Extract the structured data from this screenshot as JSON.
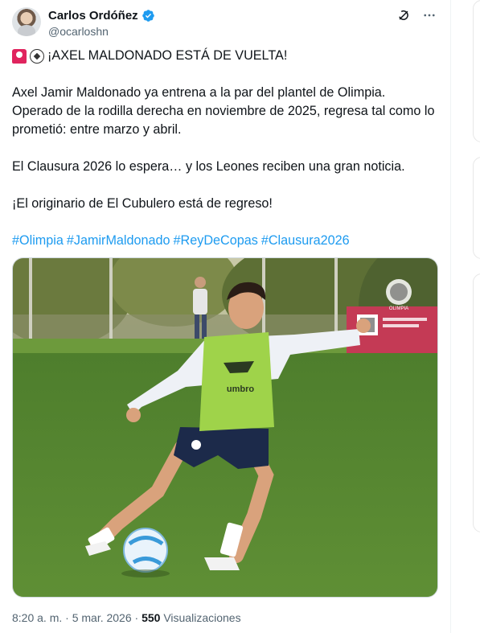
{
  "author": {
    "name": "Carlos Ordóñez",
    "handle": "@ocarloshn",
    "verified": true
  },
  "tweet": {
    "headline": "¡AXEL MALDONADO ESTÁ DE VUELTA!",
    "lines": [
      "Axel Jamir Maldonado ya entrena a la par del plantel de Olimpia.",
      "Operado de la rodilla derecha en noviembre de 2025, regresa tal como lo",
      "prometió: entre marzo y abril."
    ],
    "line2": "El Clausura 2026 lo espera… y los Leones reciben una gran noticia.",
    "line3": "¡El originario de El Cubulero está de regreso!",
    "hashtags": [
      "#Olimpia",
      "#JamirMaldonado",
      "#ReyDeCopas",
      "#Clausura2026"
    ]
  },
  "photo": {
    "bib_brand": "umbro",
    "banner_logo": "OLIMPIA"
  },
  "meta": {
    "time": "8:20 a. m. · 5 mar. 2026 · ",
    "views_count": "550",
    "views_label": " Visualizaciones"
  },
  "icons": {
    "grok": "grok-icon",
    "more": "more-icon",
    "verified": "verified-badge-icon"
  },
  "colors": {
    "link": "#1d9bf0",
    "verified": "#1d9bf0",
    "text": "#0f1419",
    "muted": "#536471"
  }
}
